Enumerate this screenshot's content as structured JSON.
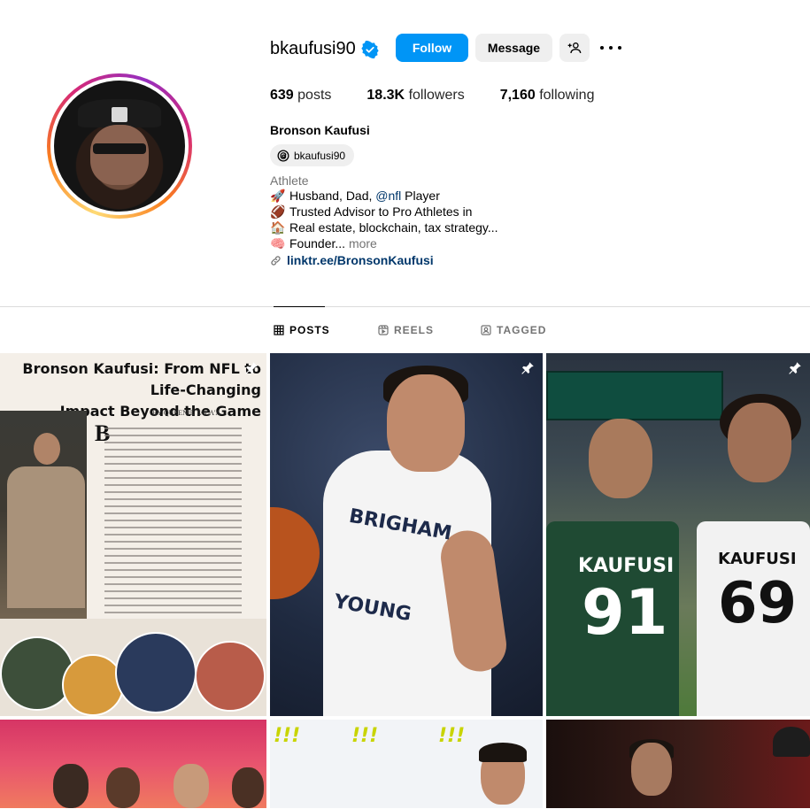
{
  "profile": {
    "username": "bkaufusi90",
    "full_name": "Bronson Kaufusi",
    "threads_handle": "bkaufusi90",
    "category": "Athlete",
    "bio": [
      {
        "emoji": "🚀",
        "pre": "Husband, Dad, ",
        "mention": "@nfl",
        "post": " Player"
      },
      {
        "emoji": "🏈",
        "pre": "Trusted Advisor to Pro Athletes in",
        "mention": "",
        "post": ""
      },
      {
        "emoji": "🏠",
        "pre": "Real estate, blockchain, tax strategy...",
        "mention": "",
        "post": ""
      },
      {
        "emoji": "🧠",
        "pre": "Founder...",
        "mention": "",
        "post": ""
      }
    ],
    "more_label": "more",
    "link": "linktr.ee/BronsonKaufusi"
  },
  "buttons": {
    "follow": "Follow",
    "message": "Message"
  },
  "stats": {
    "posts_count": "639",
    "posts_label": "posts",
    "followers_count": "18.3K",
    "followers_label": "followers",
    "following_count": "7,160",
    "following_label": "following"
  },
  "tabs": {
    "posts": "POSTS",
    "reels": "REELS",
    "tagged": "TAGGED"
  },
  "posts": {
    "p1": {
      "headline_1": "Bronson Kaufusi: From NFL to Life-Changing",
      "headline_2": "Impact Beyond the Game",
      "byline": "BY QUEENIE TALA'A",
      "dropcap": "B"
    },
    "p2": {
      "jersey_1": "BRIGHAM",
      "jersey_2": "YOUNG"
    },
    "p3": {
      "name_green": "KAUFUSI",
      "num_green": "91",
      "name_white": "KAUFUSI",
      "num_white": "69"
    }
  },
  "colors": {
    "follow_blue": "#0095f6",
    "link_blue": "#00376b",
    "verified_blue": "#0095f6"
  },
  "icons": {
    "verified": "verified-badge-icon",
    "add_user": "add-user-icon",
    "more": "more-options-icon",
    "threads": "threads-icon",
    "link": "link-icon",
    "grid": "grid-icon",
    "reels": "reels-icon",
    "tagged": "tagged-icon",
    "pin": "pin-icon"
  }
}
